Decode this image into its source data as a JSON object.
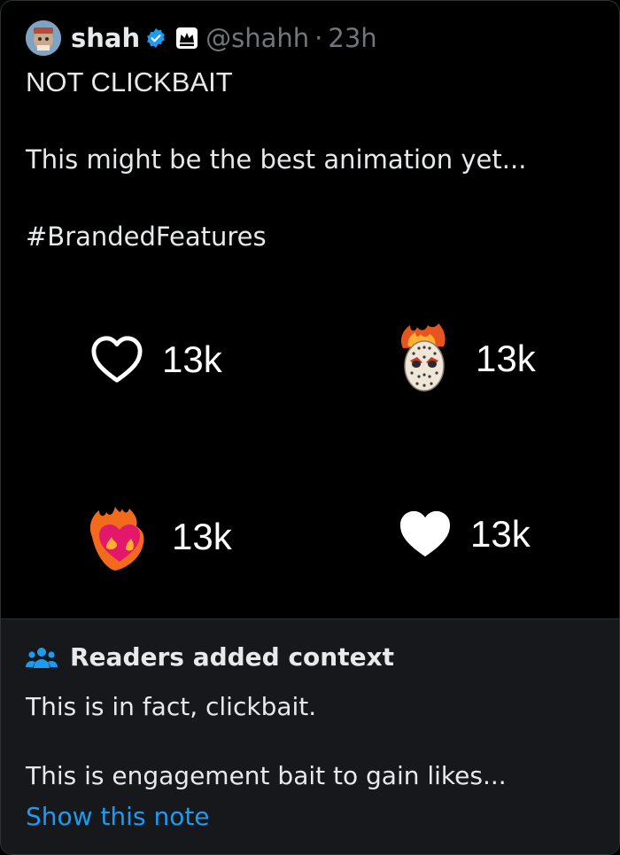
{
  "post": {
    "display_name": "shah",
    "handle": "@shahh",
    "separator": "·",
    "time": "23h",
    "lines": [
      "NOT CLICKBAIT",
      "This might be the best animation yet...",
      "#BrandedFeatures"
    ]
  },
  "stats": [
    {
      "icon": "heart-outline-icon",
      "value": "13k"
    },
    {
      "icon": "hockey-mask-icon",
      "value": "13k"
    },
    {
      "icon": "heart-on-fire-icon",
      "value": "13k"
    },
    {
      "icon": "filled-heart-icon",
      "value": "13k"
    }
  ],
  "context_note": {
    "title": "Readers added context",
    "line1": "This is in fact, clickbait.",
    "line2": "This is engagement bait to gain likes...",
    "link": "Show this note"
  },
  "colors": {
    "background": "#000000",
    "note_background": "#16181c",
    "link": "#1d9bf0",
    "verified": "#1d9bf0",
    "muted": "#71767b"
  }
}
